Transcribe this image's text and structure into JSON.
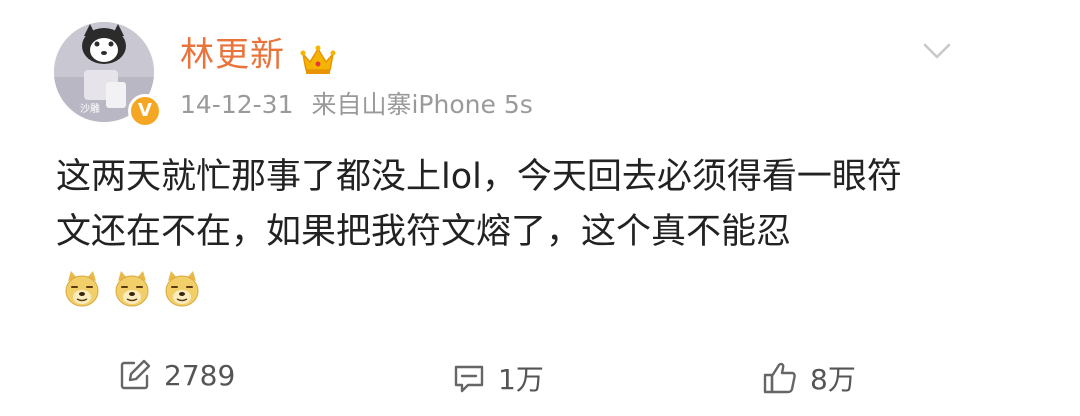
{
  "post": {
    "author": {
      "name": "林更新",
      "avatar_icon": "husky-avatar-icon",
      "verified_icon": "verified-v-icon",
      "verified_label": "V",
      "vip_icon": "crown-icon",
      "name_color": "#e8743b"
    },
    "meta": {
      "date": "14-12-31",
      "source": "来自山寨iPhone 5s"
    },
    "menu_icon": "chevron-down-icon",
    "content": {
      "text": "这两天就忙那事了都没上lol，今天回去必须得看一眼符文还在不在，如果把我符文熔了，这个真不能忍",
      "emojis": [
        "doge-emoji",
        "doge-emoji",
        "doge-emoji"
      ]
    },
    "actions": {
      "repost": {
        "icon": "repost-icon",
        "count": "2789"
      },
      "comment": {
        "icon": "comment-icon",
        "count": "1万"
      },
      "like": {
        "icon": "thumbs-up-icon",
        "count": "8万"
      }
    }
  }
}
